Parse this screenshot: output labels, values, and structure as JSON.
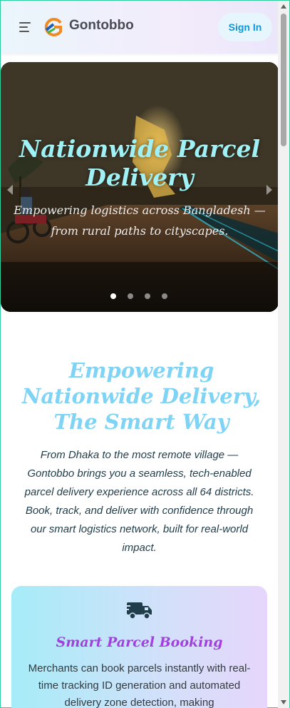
{
  "header": {
    "brand": "Gontobbo",
    "signin_label": "Sign In"
  },
  "hero": {
    "title": "Nationwide Parcel Delivery",
    "subtitle": "Empowering logistics across Bangladesh — from rural paths to cityscapes.",
    "slides": 4,
    "active_slide": 1
  },
  "intro": {
    "title": "Empowering Nationwide Delivery, The Smart Way",
    "text": "From Dhaka to the most remote village — Gontobbo brings you a seamless, tech-enabled parcel delivery experience across all 64 districts. Book, track, and deliver with confidence through our smart logistics network, built for real-world impact."
  },
  "feature_card": {
    "icon": "truck-icon",
    "title": "Smart Parcel Booking",
    "text": "Merchants can book parcels instantly with real-time tracking ID generation and automated delivery zone detection, making"
  },
  "colors": {
    "accent": "#1296d8",
    "hero_title": "#9ff1f6",
    "section_title": "#7fd4f5",
    "card_title": "#a23fe0"
  }
}
